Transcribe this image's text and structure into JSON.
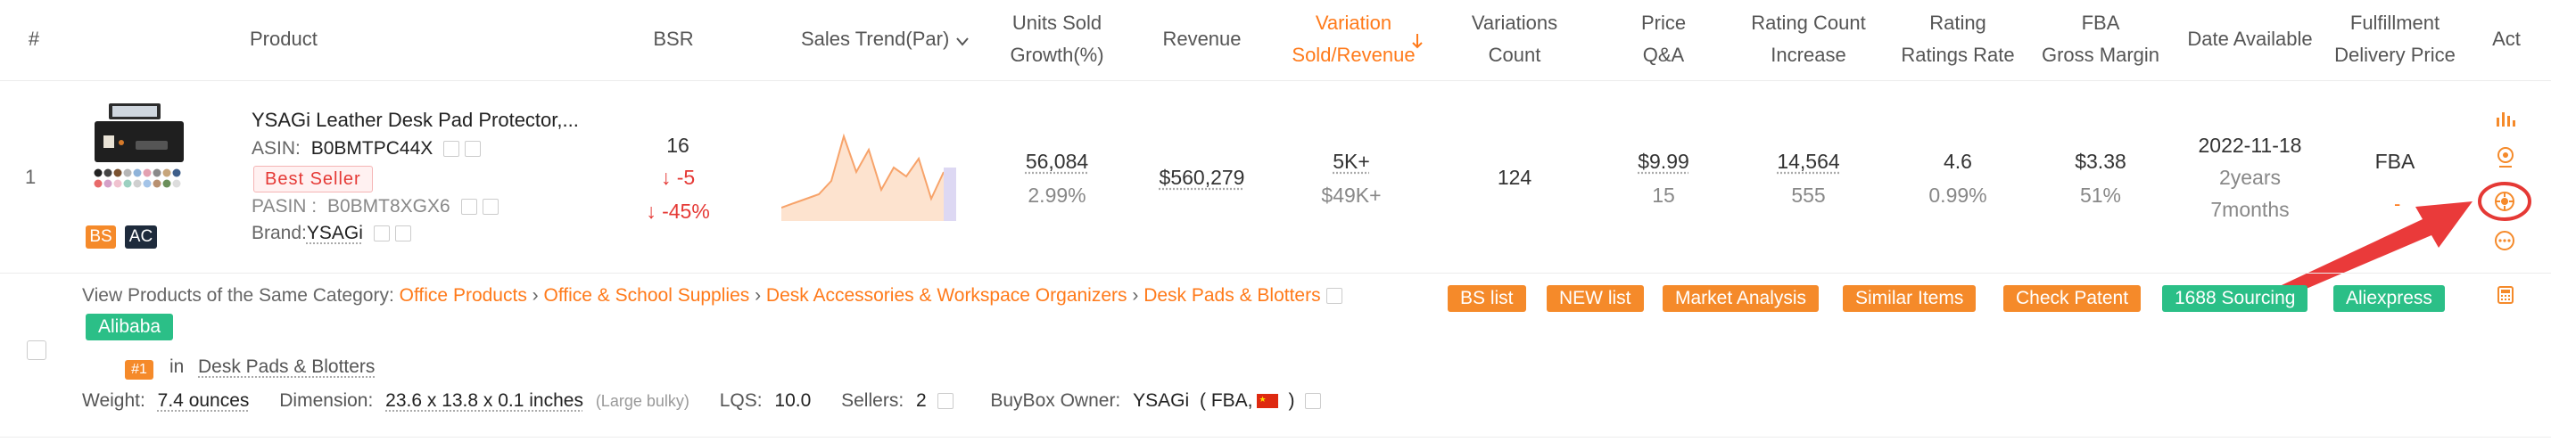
{
  "header": {
    "index": "#",
    "product": "Product",
    "bsr": "BSR",
    "sales_trend": "Sales Trend(Par)",
    "units_growth_1": "Units Sold",
    "units_growth_2": "Growth(%)",
    "revenue": "Revenue",
    "variation_1": "Variation",
    "variation_2": "Sold/Revenue",
    "variations_count_1": "Variations",
    "variations_count_2": "Count",
    "price_1": "Price",
    "price_2": "Q&A",
    "rating_count_1": "Rating Count",
    "rating_count_2": "Increase",
    "rating_1": "Rating",
    "rating_2": "Ratings Rate",
    "fba_1": "FBA",
    "fba_2": "Gross Margin",
    "date": "Date Available",
    "fulfill_1": "Fulfillment",
    "fulfill_2": "Delivery Price",
    "act": "Act"
  },
  "row": {
    "index": "1",
    "title": "YSAGi Leather Desk Pad Protector,...",
    "asin_label": "ASIN:",
    "asin": "B0BMTPC44X",
    "best_seller": "Best Seller",
    "pasin_label": "PASIN :",
    "pasin": "B0BMT8XGX6",
    "brand_label": "Brand:",
    "brand": "YSAGi",
    "badge_bs": "BS",
    "badge_ac": "AC",
    "bsr": "16",
    "bsr_change": "-5",
    "bsr_change_pct": "-45%",
    "units": "56,084",
    "growth": "2.99%",
    "revenue": "$560,279",
    "variation_sold": "5K+",
    "variation_revenue": "$49K+",
    "variations_count": "124",
    "price": "$9.99",
    "qa": "15",
    "rating_count": "14,564",
    "rating_increase": "555",
    "rating": "4.6",
    "rating_rate": "0.99%",
    "fba": "$3.38",
    "gross_margin": "51%",
    "date": "2022-11-18",
    "age_years": "2years",
    "age_months": "7months",
    "fulfillment": "FBA"
  },
  "sparkline": [
    0.15,
    0.2,
    0.25,
    0.3,
    0.45,
    0.95,
    0.55,
    0.8,
    0.35,
    0.6,
    0.5,
    0.7,
    0.25,
    0.55
  ],
  "category": {
    "label": "View Products of the Same Category:",
    "path": [
      "Office Products",
      "Office & School Supplies",
      "Desk Accessories & Workspace Organizers",
      "Desk Pads & Blotters"
    ]
  },
  "buttons": {
    "bs_list": "BS list",
    "new_list": "NEW list",
    "market": "Market Analysis",
    "similar": "Similar Items",
    "patent": "Check Patent",
    "sourcing": "1688 Sourcing",
    "aliexpress": "Aliexpress",
    "alibaba": "Alibaba"
  },
  "rank": {
    "badge": "#1",
    "in": "in",
    "category": "Desk Pads & Blotters"
  },
  "details": {
    "weight_label": "Weight:",
    "weight": "7.4 ounces",
    "dimension_label": "Dimension:",
    "dimension": "23.6 x 13.8 x 0.1 inches",
    "dimension_note": "(Large bulky)",
    "lqs_label": "LQS:",
    "lqs": "10.0",
    "sellers_label": "Sellers:",
    "sellers": "2",
    "buybox_label": "BuyBox Owner:",
    "buybox": "YSAGi",
    "buybox_type": "( FBA,",
    "buybox_close": ")"
  },
  "colors": {
    "accent": "#ff7a1a",
    "green": "#2bbf87",
    "red": "#e53935"
  }
}
